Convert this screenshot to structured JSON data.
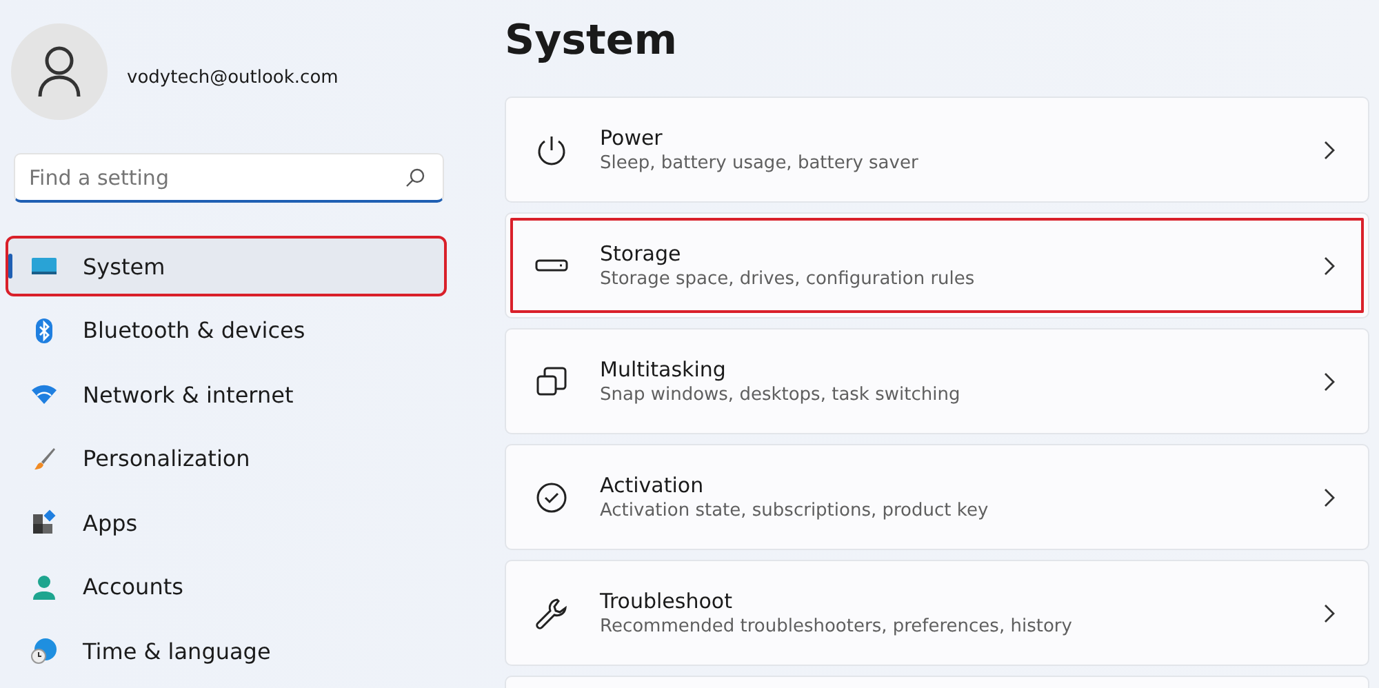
{
  "account": {
    "email": "vodytech@outlook.com"
  },
  "search": {
    "placeholder": "Find a setting"
  },
  "sidebar": {
    "items": [
      {
        "label": "System",
        "kind": "system",
        "selected": true,
        "highlighted": true
      },
      {
        "label": "Bluetooth & devices",
        "kind": "bluetooth",
        "selected": false,
        "highlighted": false
      },
      {
        "label": "Network & internet",
        "kind": "wifi",
        "selected": false,
        "highlighted": false
      },
      {
        "label": "Personalization",
        "kind": "brush",
        "selected": false,
        "highlighted": false
      },
      {
        "label": "Apps",
        "kind": "apps",
        "selected": false,
        "highlighted": false
      },
      {
        "label": "Accounts",
        "kind": "person",
        "selected": false,
        "highlighted": false
      },
      {
        "label": "Time & language",
        "kind": "globe",
        "selected": false,
        "highlighted": false
      }
    ]
  },
  "main": {
    "title": "System",
    "cards": [
      {
        "title": "Power",
        "subtitle": "Sleep, battery usage, battery saver",
        "kind": "power",
        "highlighted": false
      },
      {
        "title": "Storage",
        "subtitle": "Storage space, drives, configuration rules",
        "kind": "drive",
        "highlighted": true
      },
      {
        "title": "Multitasking",
        "subtitle": "Snap windows, desktops, task switching",
        "kind": "windows",
        "highlighted": false
      },
      {
        "title": "Activation",
        "subtitle": "Activation state, subscriptions, product key",
        "kind": "check",
        "highlighted": false
      },
      {
        "title": "Troubleshoot",
        "subtitle": "Recommended troubleshooters, preferences, history",
        "kind": "wrench",
        "highlighted": false
      }
    ]
  }
}
